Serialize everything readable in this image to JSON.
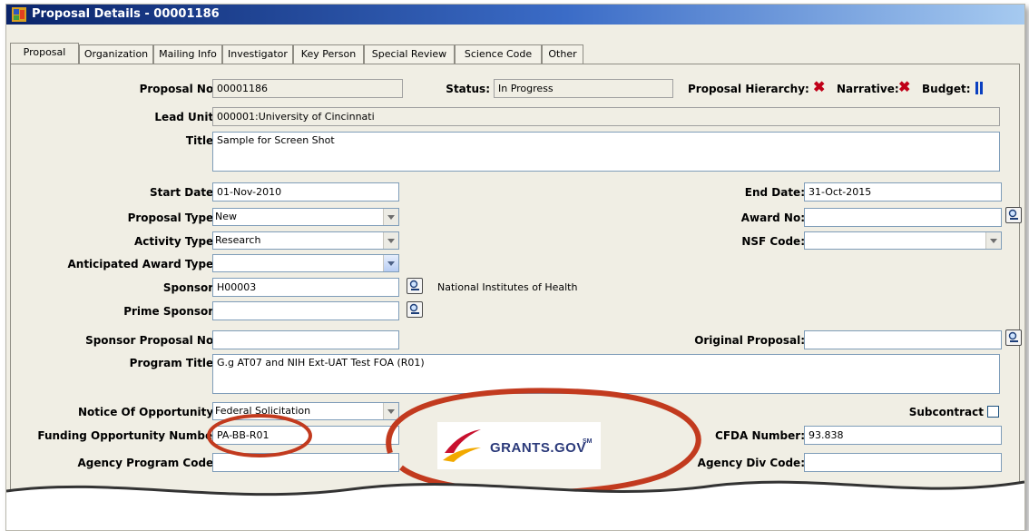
{
  "window": {
    "title": "Proposal Details - 00001186"
  },
  "tabs": [
    "Proposal",
    "Organization",
    "Mailing Info",
    "Investigator",
    "Key Person",
    "Special Review",
    "Science Code",
    "Other"
  ],
  "labels": {
    "proposal_no": "Proposal No:",
    "status": "Status:",
    "hierarchy": "Proposal Hierarchy:",
    "narrative": "Narrative:",
    "budget": "Budget:",
    "lead_unit": "Lead Unit:",
    "title": "Title:",
    "start_date": "Start Date:",
    "end_date": "End Date:",
    "proposal_type": "Proposal Type:",
    "award_no": "Award No:",
    "activity_type": "Activity Type:",
    "nsf_code": "NSF Code:",
    "anticipated_award_type": "Anticipated Award Type:",
    "sponsor": "Sponsor:",
    "prime_sponsor": "Prime Sponsor:",
    "sponsor_proposal_no": "Sponsor Proposal No:",
    "original_proposal": "Original Proposal:",
    "program_title": "Program Title:",
    "notice_of_opportunity": "Notice Of Opportunity:",
    "subcontract": "Subcontract",
    "funding_opportunity_number": "Funding Opportunity Number",
    "cfda_number": "CFDA Number:",
    "agency_program_code": "Agency Program Code:",
    "agency_div_code": "Agency Div Code:"
  },
  "values": {
    "proposal_no": "00001186",
    "status": "In Progress",
    "lead_unit": "000001:University of Cincinnati",
    "title": "Sample for Screen Shot",
    "start_date": "01-Nov-2010",
    "end_date": "31-Oct-2015",
    "proposal_type": "New",
    "award_no": "",
    "activity_type": "Research",
    "nsf_code": "",
    "anticipated_award_type": "",
    "sponsor": "H00003",
    "sponsor_name": "National Institutes of Health",
    "prime_sponsor": "",
    "sponsor_proposal_no": "",
    "original_proposal": "",
    "program_title": "G.g AT07 and NIH Ext-UAT Test FOA (R01)",
    "notice_of_opportunity": "Federal Solicitation",
    "funding_opportunity_number": "PA-BB-R01",
    "cfda_number": "93.838",
    "agency_program_code": "",
    "agency_div_code": ""
  },
  "status_icons": {
    "hierarchy": "red-x-icon",
    "narrative": "red-x-icon",
    "budget": "blue-pause-bars-icon"
  },
  "logo": {
    "text": "GRANTS.GOV",
    "mark": "SM"
  },
  "colors": {
    "title_bar": "#0a246a",
    "highlight_ring": "#c23a1e",
    "x_mark": "#c00018",
    "budget_icon": "#0a3fc0"
  }
}
